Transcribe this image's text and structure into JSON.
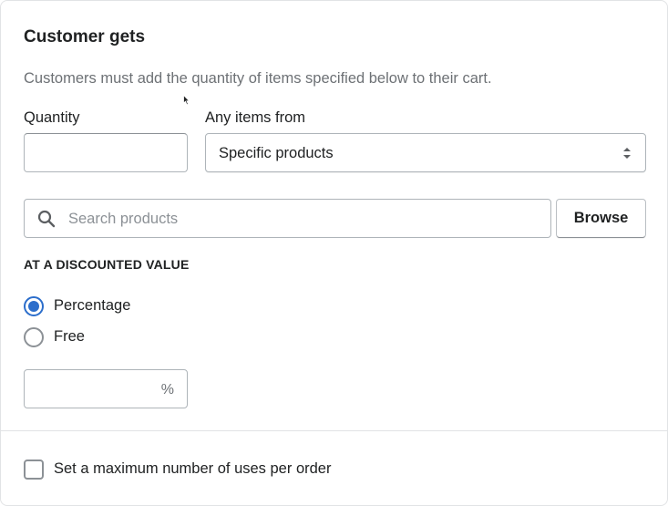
{
  "section": {
    "title": "Customer gets",
    "description": "Customers must add the quantity of items specified below to their cart."
  },
  "quantity": {
    "label": "Quantity",
    "value": ""
  },
  "items_from": {
    "label": "Any items from",
    "selected": "Specific products"
  },
  "search": {
    "placeholder": "Search products",
    "icon": "search-icon",
    "browse_label": "Browse"
  },
  "discounted_value": {
    "heading": "AT A DISCOUNTED VALUE",
    "options": [
      {
        "label": "Percentage",
        "checked": true
      },
      {
        "label": "Free",
        "checked": false
      }
    ],
    "percent_value": "",
    "percent_suffix": "%"
  },
  "max_uses": {
    "label": "Set a maximum number of uses per order",
    "checked": false
  },
  "colors": {
    "accent": "#2c6ecb",
    "text": "#202223",
    "subdued": "#6d7175",
    "border": "#aeb4b9"
  }
}
